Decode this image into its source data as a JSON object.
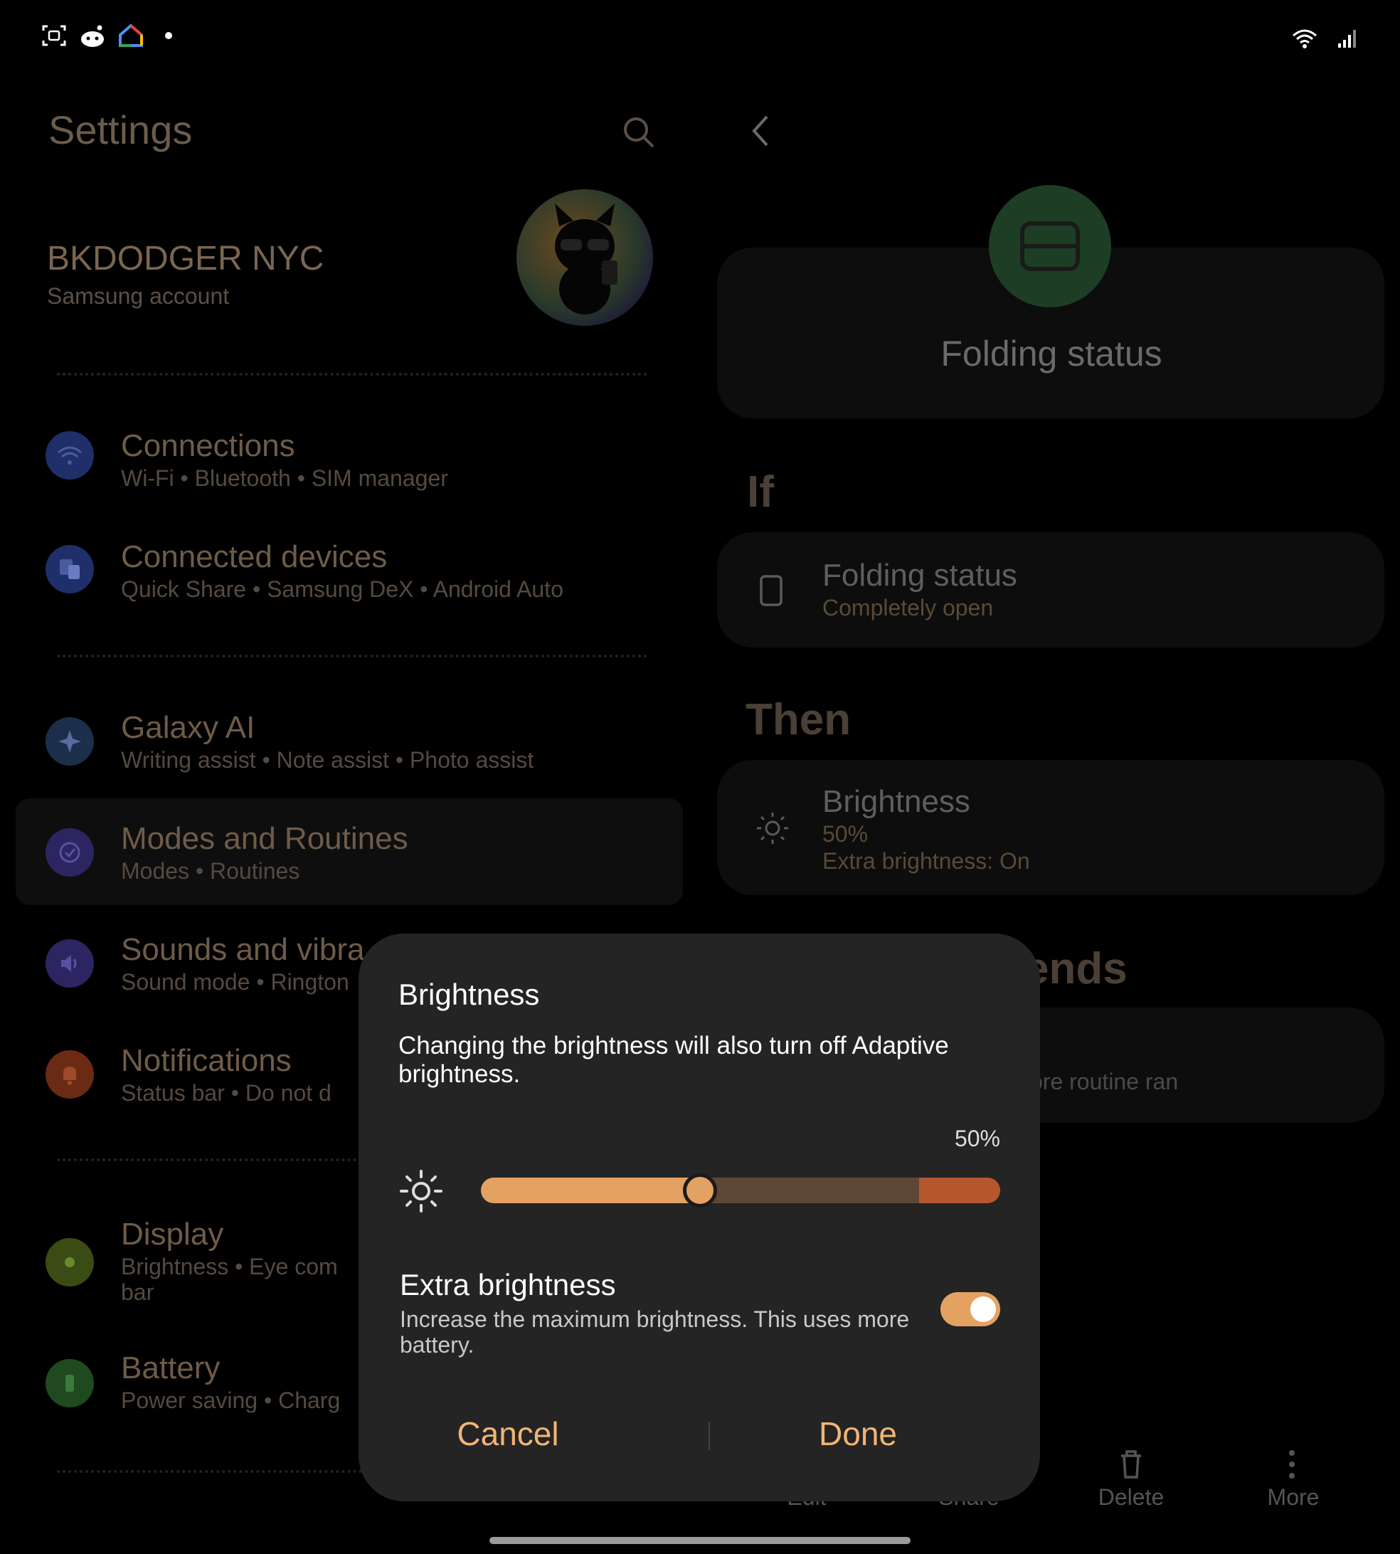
{
  "left_pane": {
    "title": "Settings",
    "account": {
      "name": "BKDODGER NYC",
      "subtitle": "Samsung account"
    },
    "items": [
      {
        "title": "Connections",
        "sub": "Wi-Fi  •  Bluetooth  •  SIM manager",
        "color": "#1f2f6a"
      },
      {
        "title": "Connected devices",
        "sub": "Quick Share  •  Samsung DeX  •  Android Auto",
        "color": "#1f2f6a"
      },
      {
        "title": "Galaxy AI",
        "sub": "Writing assist  •  Note assist  •  Photo assist",
        "color": "#1b2f4a"
      },
      {
        "title": "Modes and Routines",
        "sub": "Modes  •  Routines",
        "color": "#2c2562"
      },
      {
        "title": "Sounds and vibra",
        "sub": "Sound mode  •  Rington",
        "color": "#2c2562"
      },
      {
        "title": "Notifications",
        "sub": "Status bar  •  Do not d",
        "color": "#6a2a14"
      },
      {
        "title": "Display",
        "sub": "Brightness  •  Eye com",
        "sub2": "bar",
        "color": "#3a4b14"
      },
      {
        "title": "Battery",
        "sub": "Power saving  •  Charg",
        "color": "#1f4a1f"
      }
    ]
  },
  "right_pane": {
    "hero_title": "Folding status",
    "if_label": "If",
    "if_card": {
      "title": "Folding status",
      "sub": "Completely open"
    },
    "then_label": "Then",
    "then_card": {
      "title": "Brightness",
      "line1": "50%",
      "line2": "Extra brightness: On"
    },
    "ends_label_partial": "ends",
    "ends_card_partial": "ore routine ran",
    "bottom_actions": {
      "edit": "Edit",
      "share": "Share",
      "delete": "Delete",
      "more": "More"
    }
  },
  "dialog": {
    "title": "Brightness",
    "message": "Changing the brightness will also turn off Adaptive brightness.",
    "percent_label": "50%",
    "brightness_fraction": 0.5,
    "extra_brightness_title": "Extra brightness",
    "extra_brightness_sub": "Increase the maximum brightness. This uses more battery.",
    "extra_brightness_on": true,
    "cancel": "Cancel",
    "done": "Done"
  },
  "colors": {
    "accent": "#e4a262",
    "extra_zone": "#b5562e",
    "dialog_bg": "#242424"
  }
}
